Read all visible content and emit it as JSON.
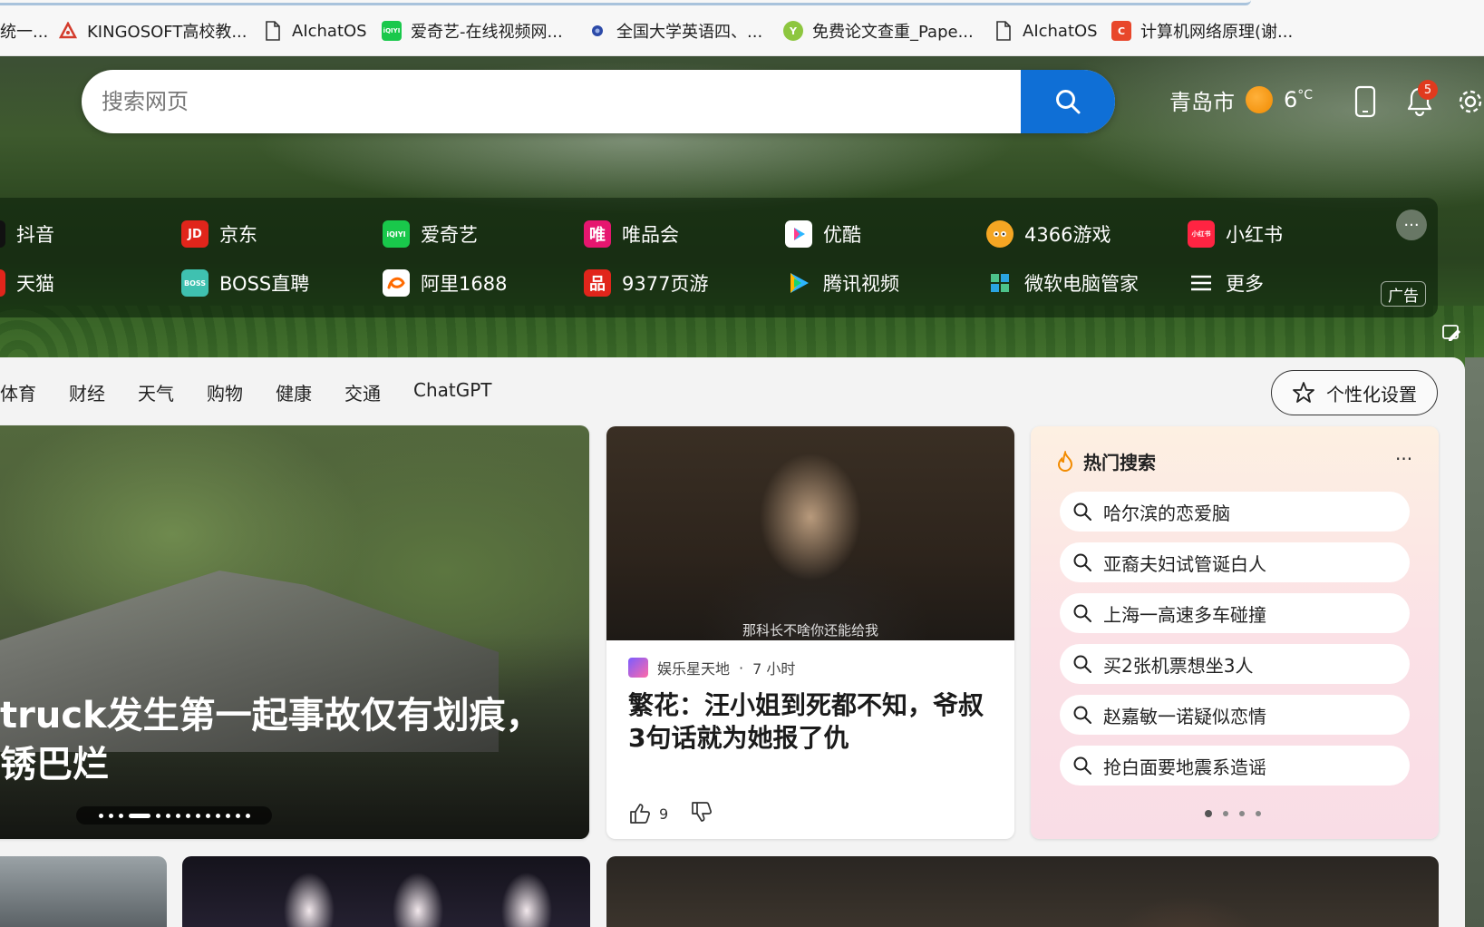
{
  "bookmarks": [
    {
      "label": "统一...",
      "icon": "page-icon"
    },
    {
      "label": "KINGOSOFT高校教...",
      "icon": "kingosoft-logo-icon",
      "color": "#d33b2c"
    },
    {
      "label": "AIchatOS",
      "icon": "page-icon"
    },
    {
      "label": "爱奇艺-在线视频网...",
      "icon": "iqiyi-logo-icon",
      "color": "#19c84b"
    },
    {
      "label": "全国大学英语四、...",
      "icon": "cet-logo-icon",
      "color": "#2c4aa8"
    },
    {
      "label": "免费论文查重_Pape...",
      "icon": "paperyy-logo-icon",
      "color": "#8dc63f"
    },
    {
      "label": "AIchatOS",
      "icon": "page-icon"
    },
    {
      "label": "计算机网络原理(谢...",
      "icon": "c-logo-icon",
      "color": "#e8472b"
    }
  ],
  "search": {
    "placeholder": "搜索网页"
  },
  "weather": {
    "city": "青岛市",
    "temp": "6",
    "unit": "°C"
  },
  "notifications": {
    "count": "5"
  },
  "quicklinks": {
    "row1": [
      {
        "label": "抖音",
        "icon": "douyin-icon",
        "color": "#111111"
      },
      {
        "label": "京东",
        "icon": "jd-icon",
        "color": "#e1251b",
        "glyph": "JD"
      },
      {
        "label": "爱奇艺",
        "icon": "iqiyi-icon",
        "color": "#19c84b",
        "glyph": "iQIYI"
      },
      {
        "label": "唯品会",
        "icon": "vip-icon",
        "color": "#e6166f",
        "glyph": "唯"
      },
      {
        "label": "优酷",
        "icon": "youku-icon",
        "color": "#ffffff"
      },
      {
        "label": "4366游戏",
        "icon": "4366-icon",
        "color": "#f5a623"
      },
      {
        "label": "小红书",
        "icon": "xiaohongshu-icon",
        "color": "#ff2442",
        "glyph": "小红书"
      }
    ],
    "row2": [
      {
        "label": "天猫",
        "icon": "tmall-icon",
        "color": "#e1251b"
      },
      {
        "label": "BOSS直聘",
        "icon": "boss-icon",
        "color": "#3fc1b0",
        "glyph": "BOSS"
      },
      {
        "label": "阿里1688",
        "icon": "ali1688-icon",
        "color": "#ff6a00"
      },
      {
        "label": "9377页游",
        "icon": "9377-icon",
        "color": "#e1251b",
        "glyph": "品"
      },
      {
        "label": "腾讯视频",
        "icon": "tencent-video-icon",
        "color": "#2cb6ff"
      },
      {
        "label": "微软电脑管家",
        "icon": "ms-pc-manager-icon",
        "color": "#4cc38a"
      },
      {
        "label": "更多",
        "icon": "menu-icon",
        "color": "#ffffff"
      }
    ],
    "ad_label": "广告",
    "more_label": "···"
  },
  "categories": [
    "体育",
    "财经",
    "天气",
    "购物",
    "健康",
    "交通",
    "ChatGPT"
  ],
  "personalize_label": "个性化设置",
  "hero_story": {
    "title": "truck发生第一起事故仅有划痕，\n锈巴烂"
  },
  "news": {
    "source": "娱乐星天地",
    "time": "7 小时",
    "title": "繁花：汪小姐到死都不知，爷叔3句话就为她报了仇",
    "likes": "9",
    "caption": "那科长不啥你还能给我"
  },
  "hot": {
    "title": "热门搜索",
    "more": "···",
    "items": [
      "哈尔滨的恋爱脑",
      "亚裔夫妇试管诞白人",
      "上海一高速多车碰撞",
      "买2张机票想坐3人",
      "赵嘉敏一诺疑似恋情",
      "抢白面要地震系造谣"
    ]
  }
}
